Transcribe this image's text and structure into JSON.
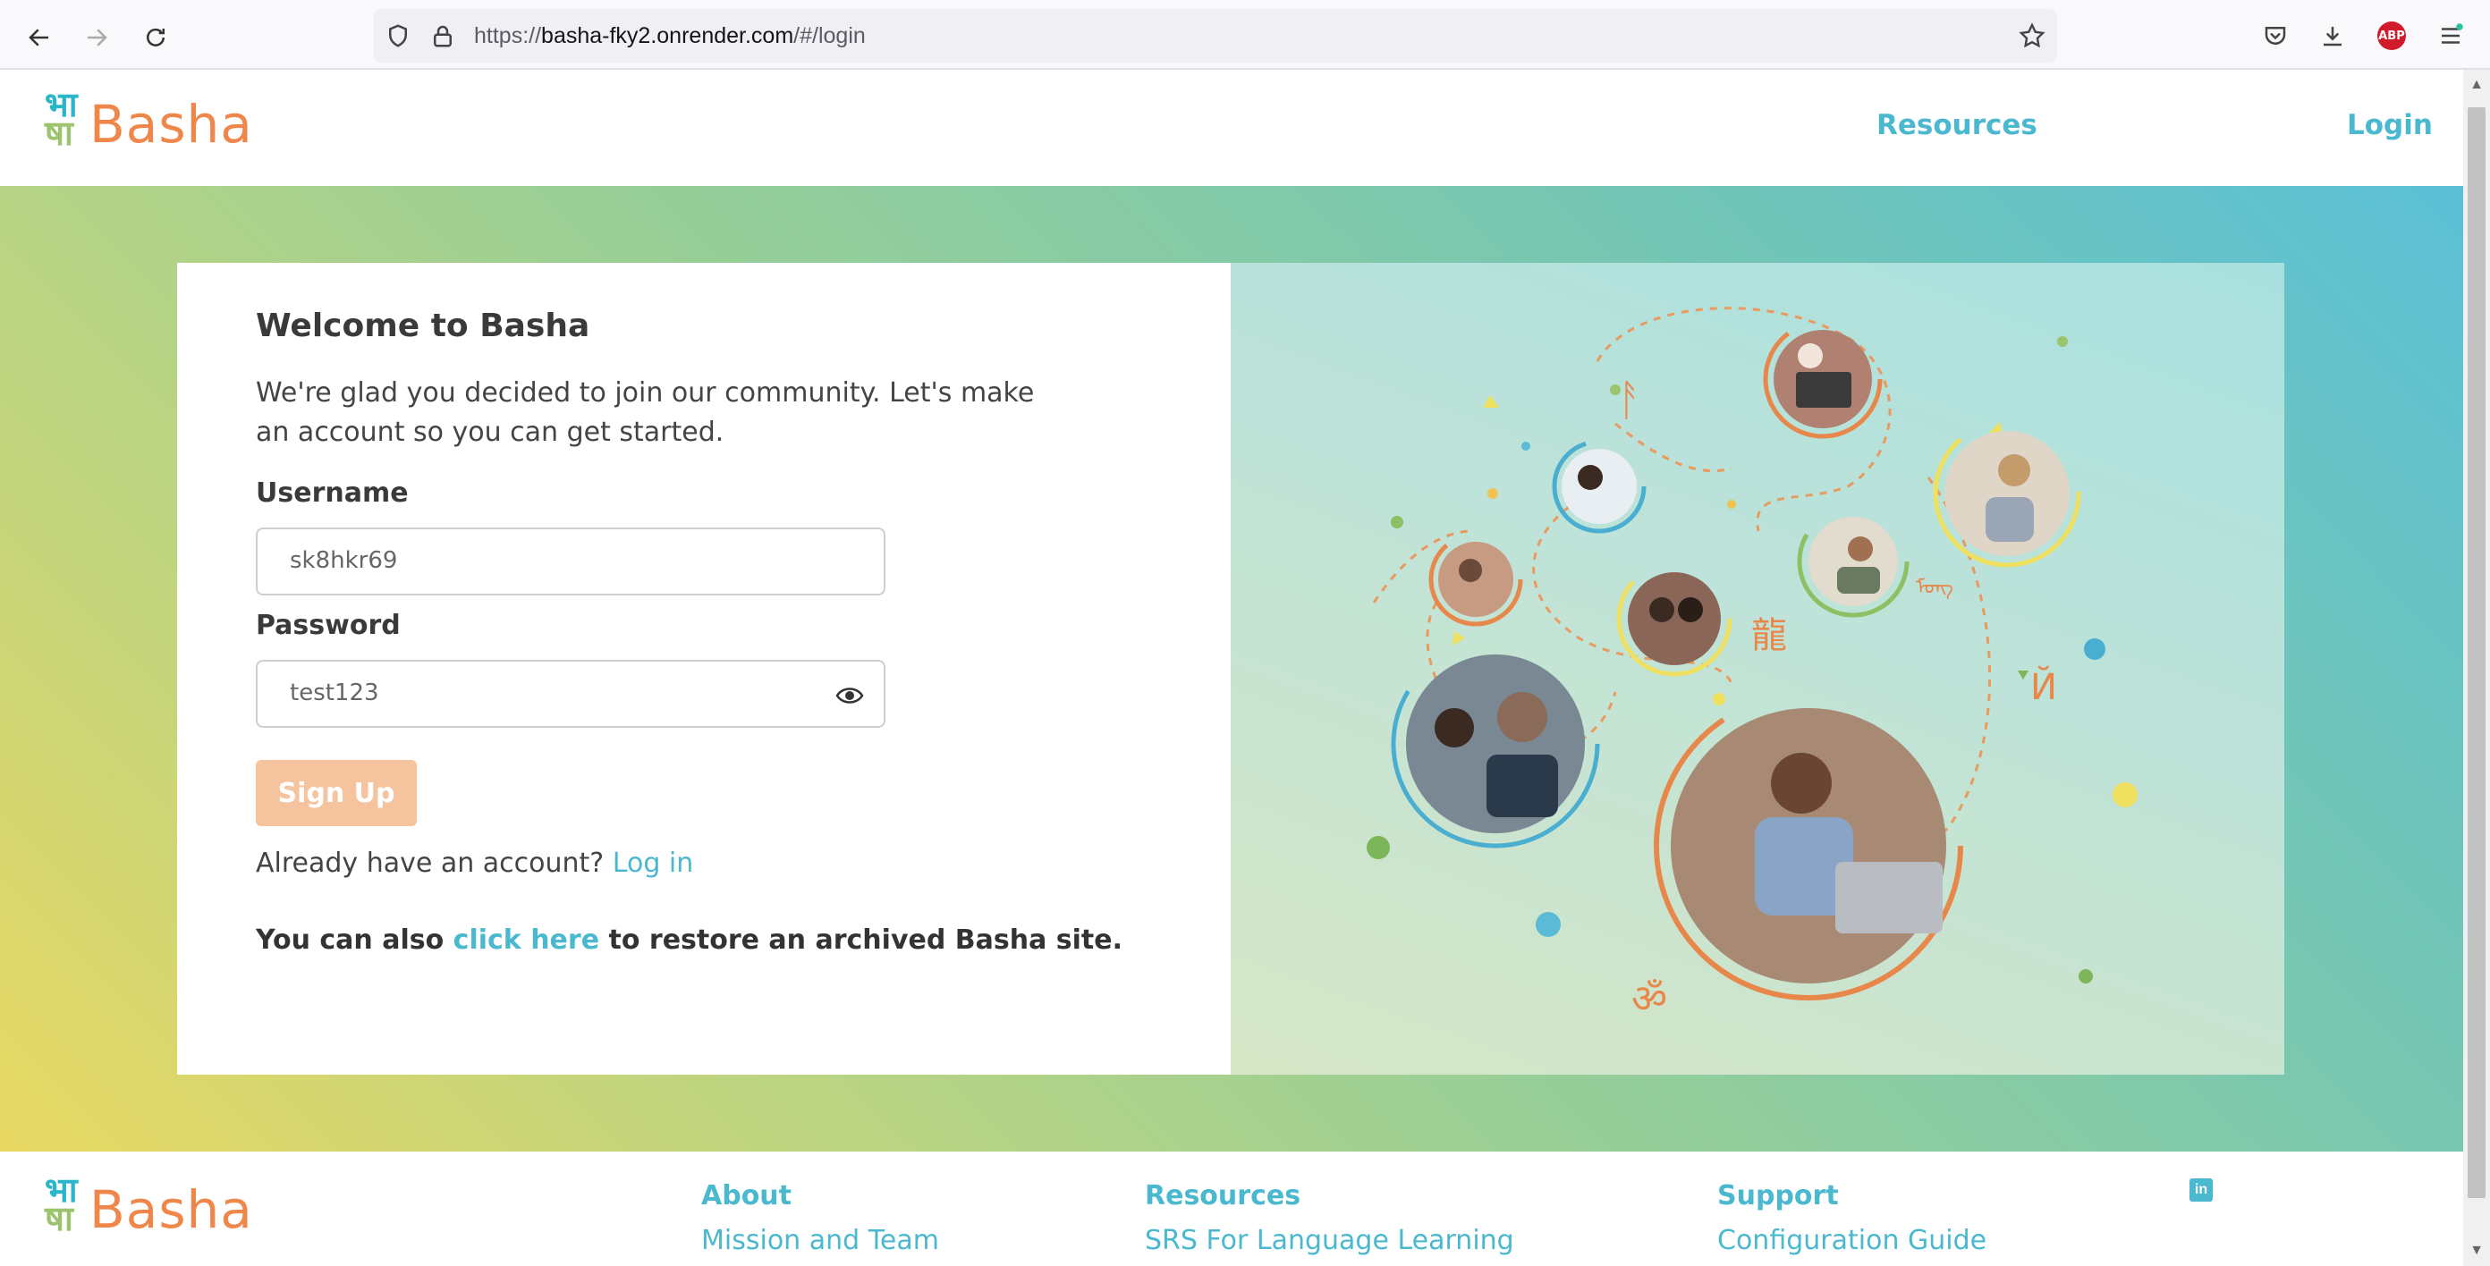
{
  "browser": {
    "url_prefix": "https://",
    "url_host": "basha-fky2.onrender.com",
    "url_path": "/#/login"
  },
  "header": {
    "logo_glyph_top": "भा",
    "logo_glyph_bottom": "षा",
    "logo_text": "Basha",
    "nav_resources": "Resources",
    "nav_login": "Login"
  },
  "signup": {
    "title": "Welcome to Basha",
    "intro": "We're glad you decided to join our community. Let's make an account so you can get started.",
    "username_label": "Username",
    "username_value": "sk8hkr69",
    "password_label": "Password",
    "password_value": "test123",
    "signup_button": "Sign Up",
    "already_text": "Already have an account?",
    "login_link": "Log in",
    "archive_prefix": "You can also",
    "archive_link": "click here",
    "archive_suffix": "to restore an archived Basha site."
  },
  "illustration": {
    "glyphs": [
      "ᚨ",
      "龍",
      "Й",
      "ॐ",
      "ᠮᠣᠩ"
    ]
  },
  "footer": {
    "logo_text": "Basha",
    "about_heading": "About",
    "about_link": "Mission and Team",
    "resources_heading": "Resources",
    "resources_link": "SRS For Language Learning",
    "support_heading": "Support",
    "support_link": "Configuration Guide",
    "linkedin_icon": "linkedin-icon"
  },
  "colors": {
    "accent_teal": "#4ab8cf",
    "accent_orange": "#f0874a",
    "button_disabled": "#f5c39e"
  }
}
